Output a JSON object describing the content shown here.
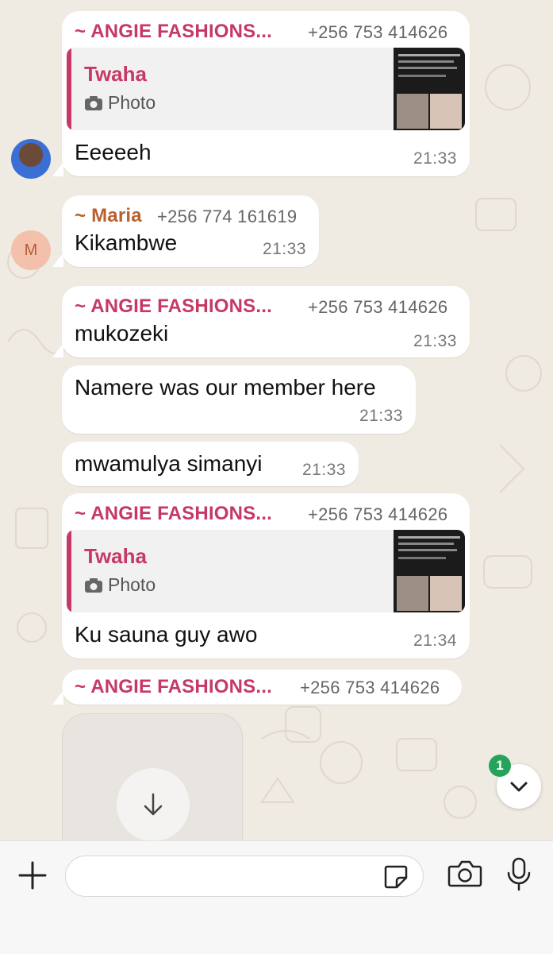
{
  "messages": [
    {
      "sender": "~ ANGIE FASHIONS...",
      "phone": "+256 753 414626",
      "quote": {
        "author": "Twaha",
        "type": "Photo"
      },
      "text": "Eeeeeh",
      "time": "21:33"
    },
    {
      "sender": "~ Maria",
      "phone": "+256 774 161619",
      "avatar_initial": "M",
      "text": "Kikambwe",
      "time": "21:33"
    },
    {
      "sender": "~ ANGIE FASHIONS...",
      "phone": "+256 753 414626",
      "text": "mukozeki",
      "time": "21:33"
    },
    {
      "text": "Namere was our member here",
      "time": "21:33"
    },
    {
      "text": "mwamulya simanyi",
      "time": "21:33"
    },
    {
      "sender": "~ ANGIE FASHIONS...",
      "phone": "+256 753 414626",
      "quote": {
        "author": "Twaha",
        "type": "Photo"
      },
      "text": "Ku sauna guy awo",
      "time": "21:34"
    },
    {
      "sender": "~ ANGIE FASHIONS...",
      "phone": "+256 753 414626"
    }
  ],
  "unread_count": "1",
  "composer": {
    "placeholder": ""
  },
  "colors": {
    "background": "#efeae2",
    "sender_pink": "#c53964",
    "sender_brown": "#b9602f",
    "badge_green": "#25a35a"
  },
  "icons": {
    "attach": "plus-icon",
    "sticker": "sticker-icon",
    "camera": "camera-icon",
    "mic": "microphone-icon",
    "scroll": "chevron-down-icon",
    "download": "download-arrow-icon"
  }
}
